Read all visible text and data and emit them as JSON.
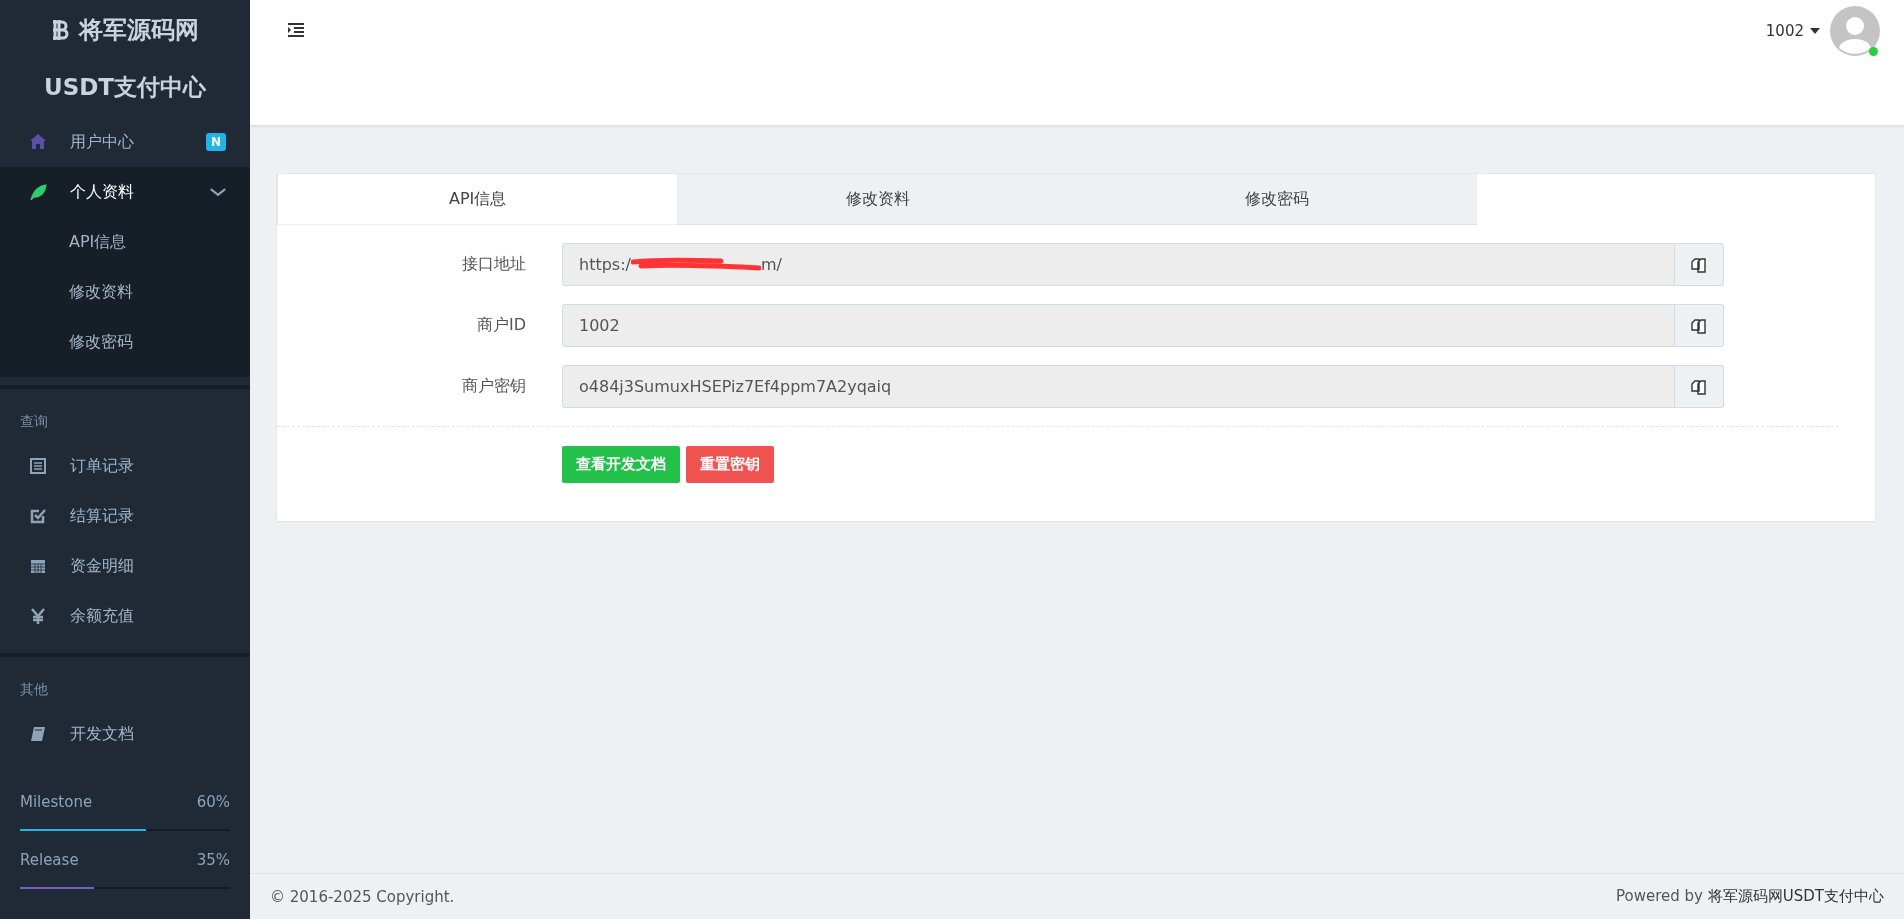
{
  "sidebar": {
    "brand": "将军源码网",
    "subtitle": "USDT支付中心",
    "menu": [
      {
        "label": "用户中心",
        "badge": "N",
        "selected": false
      },
      {
        "label": "个人资料",
        "selected": true,
        "children": [
          {
            "label": "API信息"
          },
          {
            "label": "修改资料"
          },
          {
            "label": "修改密码"
          }
        ]
      }
    ],
    "sections": [
      {
        "title": "查询",
        "items": [
          {
            "label": "订单记录"
          },
          {
            "label": "结算记录"
          },
          {
            "label": "资金明细"
          },
          {
            "label": "余额充值"
          }
        ]
      },
      {
        "title": "其他",
        "items": [
          {
            "label": "开发文档"
          }
        ]
      }
    ],
    "progress": [
      {
        "label": "Milestone",
        "reading": "60%",
        "level": 0.6,
        "color": "#1fb5e8"
      },
      {
        "label": "Release",
        "reading": "35%",
        "level": 0.35,
        "color": "#7460c7"
      }
    ]
  },
  "header": {
    "user": "1002",
    "online": true
  },
  "tabs": [
    {
      "label": "API信息",
      "selected": true
    },
    {
      "label": "修改资料",
      "selected": false
    },
    {
      "label": "修改密码",
      "selected": false
    }
  ],
  "fields": [
    {
      "label": "接口地址",
      "value_prefix": "https:/",
      "value_suffix": "m/",
      "redacted": true
    },
    {
      "label": "商户ID",
      "value_prefix": "1002"
    },
    {
      "label": "商户密钥",
      "value_prefix": "o484j3SumuxHSEPiz7Ef4ppm7A2yqaiq"
    }
  ],
  "buttons": [
    {
      "label": "查看开发文档",
      "kind": "primary"
    },
    {
      "label": "重置密钥",
      "kind": "danger"
    }
  ],
  "footer": {
    "copyright": "© 2016-2025 Copyright.",
    "powered_prefix": "Powered by ",
    "powered_name": "将军源码网USDT支付中心"
  }
}
